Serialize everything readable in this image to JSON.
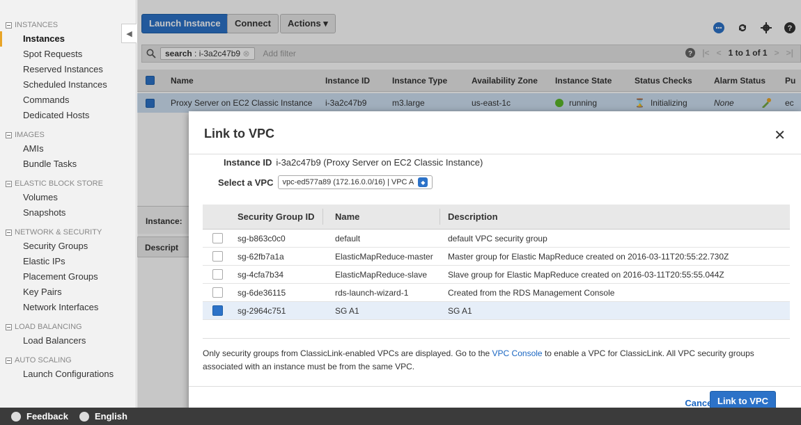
{
  "sidebar": {
    "sections": [
      {
        "title": "INSTANCES",
        "items": [
          "Instances",
          "Spot Requests",
          "Reserved Instances",
          "Scheduled Instances",
          "Commands",
          "Dedicated Hosts"
        ]
      },
      {
        "title": "IMAGES",
        "items": [
          "AMIs",
          "Bundle Tasks"
        ]
      },
      {
        "title": "ELASTIC BLOCK STORE",
        "items": [
          "Volumes",
          "Snapshots"
        ]
      },
      {
        "title": "NETWORK & SECURITY",
        "items": [
          "Security Groups",
          "Elastic IPs",
          "Placement Groups",
          "Key Pairs",
          "Network Interfaces"
        ]
      },
      {
        "title": "LOAD BALANCING",
        "items": [
          "Load Balancers"
        ]
      },
      {
        "title": "AUTO SCALING",
        "items": [
          "Launch Configurations"
        ]
      }
    ]
  },
  "footer": {
    "feedback": "Feedback",
    "language": "English"
  },
  "toolbar": {
    "launch": "Launch Instance",
    "connect": "Connect",
    "actions": "Actions"
  },
  "search": {
    "key": "search",
    "value": "i-3a2c47b9",
    "add_filter": "Add filter",
    "pager": "1 to 1 of 1"
  },
  "grid": {
    "headers": [
      "Name",
      "Instance ID",
      "Instance Type",
      "Availability Zone",
      "Instance State",
      "Status Checks",
      "Alarm Status",
      "Pu"
    ],
    "row": {
      "name": "Proxy Server on EC2 Classic Instance",
      "id": "i-3a2c47b9",
      "type": "m3.large",
      "zone": "us-east-1c",
      "state": "running",
      "status": "Initializing",
      "alarm": "None",
      "pub": "ec"
    }
  },
  "lower": {
    "instance_label": "Instance:",
    "tab": "Descript"
  },
  "modal": {
    "title": "Link to VPC",
    "instance_id_label": "Instance ID",
    "instance_id_value": "i-3a2c47b9 (Proxy Server on EC2 Classic Instance)",
    "vpc_label": "Select a VPC",
    "vpc_value": "vpc-ed577a89 (172.16.0.0/16) | VPC A",
    "table_headers": [
      "Security Group ID",
      "Name",
      "Description"
    ],
    "groups": [
      {
        "id": "sg-b863c0c0",
        "name": "default",
        "desc": "default VPC security group",
        "checked": false
      },
      {
        "id": "sg-62fb7a1a",
        "name": "ElasticMapReduce-master",
        "desc": "Master group for Elastic MapReduce created on 2016-03-11T20:55:22.730Z",
        "checked": false
      },
      {
        "id": "sg-4cfa7b34",
        "name": "ElasticMapReduce-slave",
        "desc": "Slave group for Elastic MapReduce created on 2016-03-11T20:55:55.044Z",
        "checked": false
      },
      {
        "id": "sg-6de36115",
        "name": "rds-launch-wizard-1",
        "desc": "Created from the RDS Management Console",
        "checked": false
      },
      {
        "id": "sg-2964c751",
        "name": "SG A1",
        "desc": "SG A1",
        "checked": true
      }
    ],
    "note_pre": "Only security groups from ClassicLink-enabled VPCs are displayed. Go to the",
    "note_link": "VPC Console",
    "note_post": "to enable a VPC for ClassicLink. All VPC security groups associated with an instance must be from the same VPC.",
    "cancel": "Cancel",
    "submit": "Link to VPC"
  },
  "colors": {
    "accent": "#2c72c8",
    "running": "#5cb82a",
    "highlight": "#cfe1f3"
  }
}
